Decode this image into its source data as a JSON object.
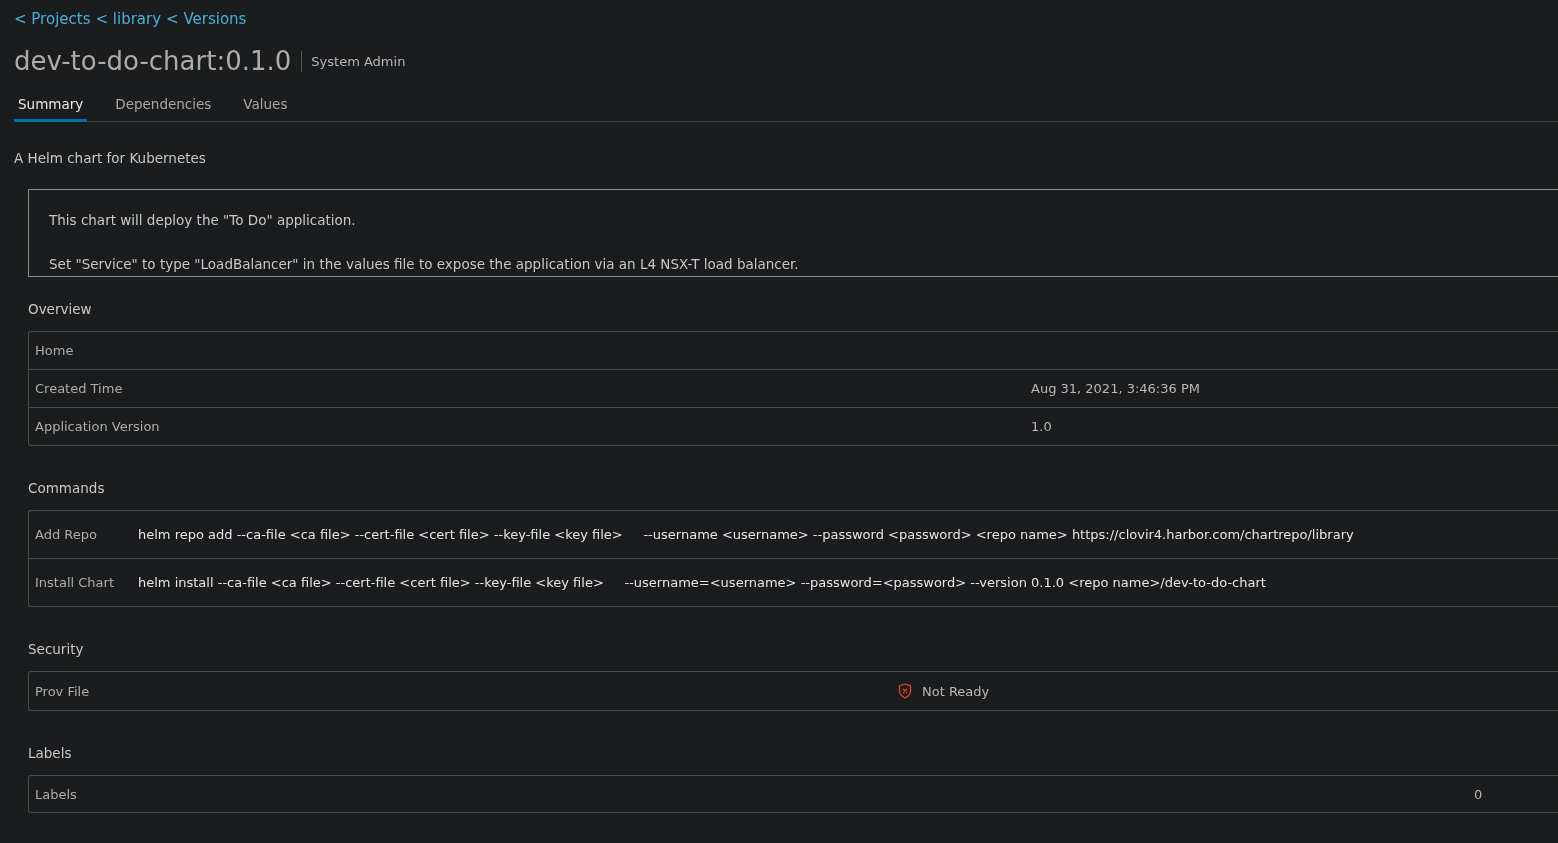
{
  "breadcrumb": [
    "< Projects",
    "< library",
    "< Versions"
  ],
  "title": "dev-to-do-chart:0.1.0",
  "role": "System Admin",
  "tabs": [
    {
      "label": "Summary",
      "selected": true
    },
    {
      "label": "Dependencies",
      "selected": false
    },
    {
      "label": "Values",
      "selected": false
    }
  ],
  "description": "A Helm chart for Kubernetes",
  "readme": [
    "This chart will deploy the \"To Do\" application.",
    "Set \"Service\" to type \"LoadBalancer\" in the values file to expose the application via an L4 NSX-T load balancer."
  ],
  "overview": {
    "heading": "Overview",
    "rows": [
      {
        "label": "Home"
      },
      {
        "label": "Created Time",
        "value": "Aug 31, 2021, 3:46:36 PM"
      },
      {
        "label": "Application Version",
        "value": "1.0"
      }
    ]
  },
  "commands": {
    "heading": "Commands",
    "rows": [
      {
        "label": "Add Repo",
        "command": "helm repo add --ca-file <ca file> --cert-file <cert file> --key-file <key file>     --username <username> --password <password> <repo name> https://clovir4.harbor.com/chartrepo/library"
      },
      {
        "label": "Install Chart",
        "command": "helm install --ca-file <ca file> --cert-file <cert file> --key-file <key file>     --username=<username> --password=<password> --version 0.1.0 <repo name>/dev-to-do-chart"
      }
    ]
  },
  "security": {
    "heading": "Security",
    "label": "Prov File",
    "ready": false,
    "status": "Not Ready"
  },
  "labels": {
    "heading": "Labels",
    "label": "Labels",
    "count": "0"
  }
}
